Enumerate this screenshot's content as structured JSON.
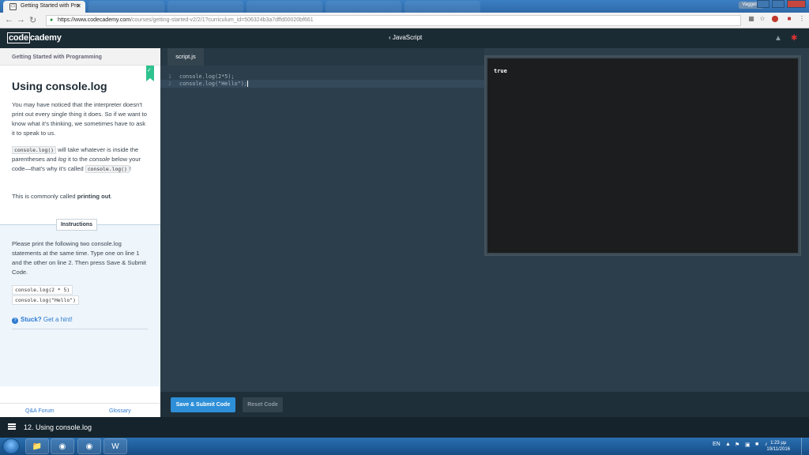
{
  "browser": {
    "tabs": [
      {
        "label": "Getting Started with Pro",
        "active": true
      },
      {
        "label": "",
        "active": false
      },
      {
        "label": "",
        "active": false
      },
      {
        "label": "",
        "active": false
      },
      {
        "label": "",
        "active": false
      },
      {
        "label": "",
        "active": false
      }
    ],
    "profile": "Vaggelis",
    "url_host": "https://www.codecademy.com",
    "url_path": "/courses/getting-started-v2/2/1?curriculum_id=506324b3a7dffd00020bf661"
  },
  "header": {
    "logo_code": "code",
    "logo_rest": "cademy",
    "breadcrumb": "JavaScript"
  },
  "sidebar": {
    "course_title": "Getting Started with Programming",
    "lesson_title": "Using console.log",
    "para1": "You may have noticed that the interpreter doesn't print out every single thing it does. So if we want to know what it's thinking, we sometimes have to ask it to speak to us.",
    "para2_code": "console.log()",
    "para2_a": " will take whatever is inside the parentheses and ",
    "para2_log": "log",
    "para2_b": " it to the ",
    "para2_console": "console",
    "para2_c": " below your code—that's why it's called",
    "para2_code2": "console.log()",
    "para2_d": "!",
    "para3_a": "This is commonly called ",
    "para3_b": "printing out",
    "para3_c": ".",
    "instructions_label": "Instructions",
    "instructions_text": "Please print the following two console.log statements at the same time. Type one on line 1 and the other on line 2. Then press Save & Submit Code.",
    "code_example_1": "console.log(2 * 5)",
    "code_example_2": "console.log(\"Hello\")",
    "hint_stuck": "Stuck?",
    "hint_link": "Get a hint!",
    "footer_qa": "Q&A Forum",
    "footer_glossary": "Glossary"
  },
  "editor": {
    "file_tab": "script.js",
    "lines": [
      {
        "num": "1",
        "code": "console.log(2*5);"
      },
      {
        "num": "2",
        "code": "console.log(\"Hello\");"
      }
    ]
  },
  "console": {
    "output": "true"
  },
  "toolbar": {
    "submit_label": "Save & Submit Code",
    "reset_label": "Reset Code"
  },
  "lesson_bar": {
    "title": "12. Using console.log"
  },
  "taskbar": {
    "lang": "EN",
    "time": "1:23 μμ",
    "date": "19/11/2016"
  },
  "colors": {
    "accent": "#2d8fd8",
    "brand_bg": "#1b2b34",
    "success": "#2ec28f"
  }
}
